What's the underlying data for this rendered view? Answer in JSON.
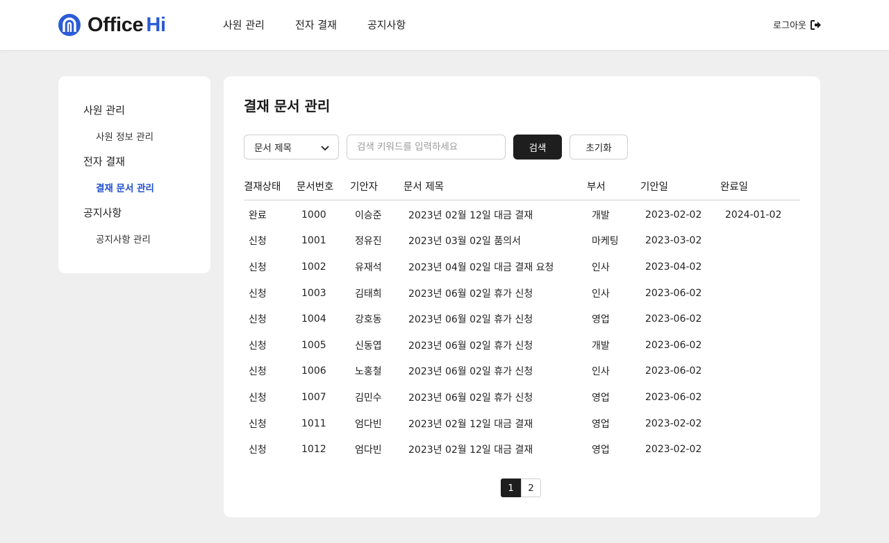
{
  "header": {
    "logo_text": "Office",
    "logo_accent": "Hi",
    "nav": [
      "사원 관리",
      "전자 결재",
      "공지사항"
    ],
    "logout_label": "로그아웃",
    "brand_color": "#2b5bd7"
  },
  "sidebar": {
    "groups": [
      {
        "label": "사원 관리",
        "items": [
          "사원 정보 관리"
        ]
      },
      {
        "label": "전자 결재",
        "items": [
          "결재 문서 관리"
        ]
      },
      {
        "label": "공지사항",
        "items": [
          "공지사항 관리"
        ]
      }
    ],
    "active_item": "결재 문서 관리"
  },
  "main": {
    "title": "결재 문서 관리",
    "filter_select_value": "문서 제목",
    "search_placeholder": "검색 키워드를 입력하세요",
    "search_label": "검색",
    "reset_label": "초기화",
    "columns": [
      "결재상태",
      "문서번호",
      "기안자",
      "문서 제목",
      "부서",
      "기안일",
      "완료일"
    ],
    "rows": [
      [
        "완료",
        "1000",
        "이승준",
        "2023년 02월 12일 대금 결재",
        "개발",
        "2023-02-02",
        "2024-01-02"
      ],
      [
        "신청",
        "1001",
        "정유진",
        "2023년 03월 02일 품의서",
        "마케팅",
        "2023-03-02",
        ""
      ],
      [
        "신청",
        "1002",
        "유재석",
        "2023년 04월 02일 대금 결재 요청",
        "인사",
        "2023-04-02",
        ""
      ],
      [
        "신청",
        "1003",
        "김태희",
        "2023년 06월 02일 휴가 신청",
        "인사",
        "2023-06-02",
        ""
      ],
      [
        "신청",
        "1004",
        "강호동",
        "2023년 06월 02일 휴가 신청",
        "영업",
        "2023-06-02",
        ""
      ],
      [
        "신청",
        "1005",
        "신동엽",
        "2023년 06월 02일 휴가 신청",
        "개발",
        "2023-06-02",
        ""
      ],
      [
        "신청",
        "1006",
        "노홍철",
        "2023년 06월 02일 휴가 신청",
        "인사",
        "2023-06-02",
        ""
      ],
      [
        "신청",
        "1007",
        "김민수",
        "2023년 06월 02일 휴가 신청",
        "영업",
        "2023-06-02",
        ""
      ],
      [
        "신청",
        "1011",
        "엄다빈",
        "2023년 02월 12일 대금 결재",
        "영업",
        "2023-02-02",
        ""
      ],
      [
        "신청",
        "1012",
        "엄다빈",
        "2023년 02월 12일 대금 결재",
        "영업",
        "2023-02-02",
        ""
      ]
    ],
    "pages": [
      "1",
      "2"
    ],
    "current_page": "1"
  }
}
